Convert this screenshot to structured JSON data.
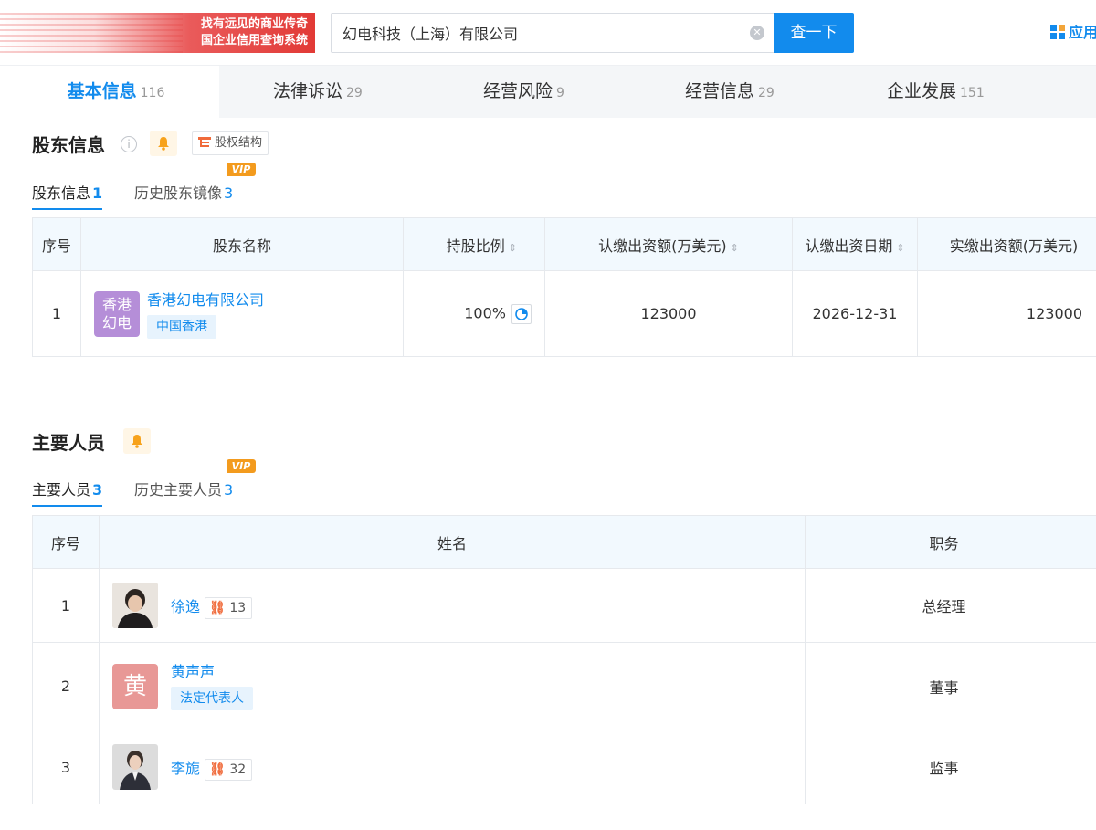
{
  "header": {
    "slogan_line1": "找有远见的商业传奇",
    "slogan_line2": "国企业信用查询系统",
    "search_value": "幻电科技（上海）有限公司",
    "search_button": "查一下",
    "app_link": "应用"
  },
  "tabs": [
    {
      "label": "基本信息",
      "count": "116"
    },
    {
      "label": "法律诉讼",
      "count": "29"
    },
    {
      "label": "经营风险",
      "count": "9"
    },
    {
      "label": "经营信息",
      "count": "29"
    },
    {
      "label": "企业发展",
      "count": "151"
    }
  ],
  "shareholders": {
    "title": "股东信息",
    "equity_button": "股权结构",
    "subtabs": [
      {
        "label": "股东信息",
        "count": "1"
      },
      {
        "label": "历史股东镜像",
        "count": "3",
        "vip": "VIP"
      }
    ],
    "columns": [
      "序号",
      "股东名称",
      "持股比例",
      "认缴出资额(万美元)",
      "认缴出资日期",
      "实缴出资额(万美元)"
    ],
    "rows": [
      {
        "index": "1",
        "avatar_line1": "香港",
        "avatar_line2": "幻电",
        "name": "香港幻电有限公司",
        "region_tag": "中国香港",
        "ratio": "100%",
        "subscribed_amount": "123000",
        "subscribed_date": "2026-12-31",
        "paid_amount": "123000"
      }
    ]
  },
  "personnel": {
    "title": "主要人员",
    "subtabs": [
      {
        "label": "主要人员",
        "count": "3"
      },
      {
        "label": "历史主要人员",
        "count": "3",
        "vip": "VIP"
      }
    ],
    "columns": [
      "序号",
      "姓名",
      "职务"
    ],
    "rows": [
      {
        "index": "1",
        "name": "徐逸",
        "relations": "13",
        "position": "总经理"
      },
      {
        "index": "2",
        "avatar_char": "黄",
        "name": "黄声声",
        "tag": "法定代表人",
        "position": "董事"
      },
      {
        "index": "3",
        "name": "李旎",
        "relations": "32",
        "position": "监事"
      }
    ]
  },
  "colors": {
    "accent": "#128bed",
    "brand_red": "#e23a36",
    "vip": "#f39b1e",
    "avatar_purple": "#b58ed8",
    "avatar_pink": "#e89896"
  }
}
